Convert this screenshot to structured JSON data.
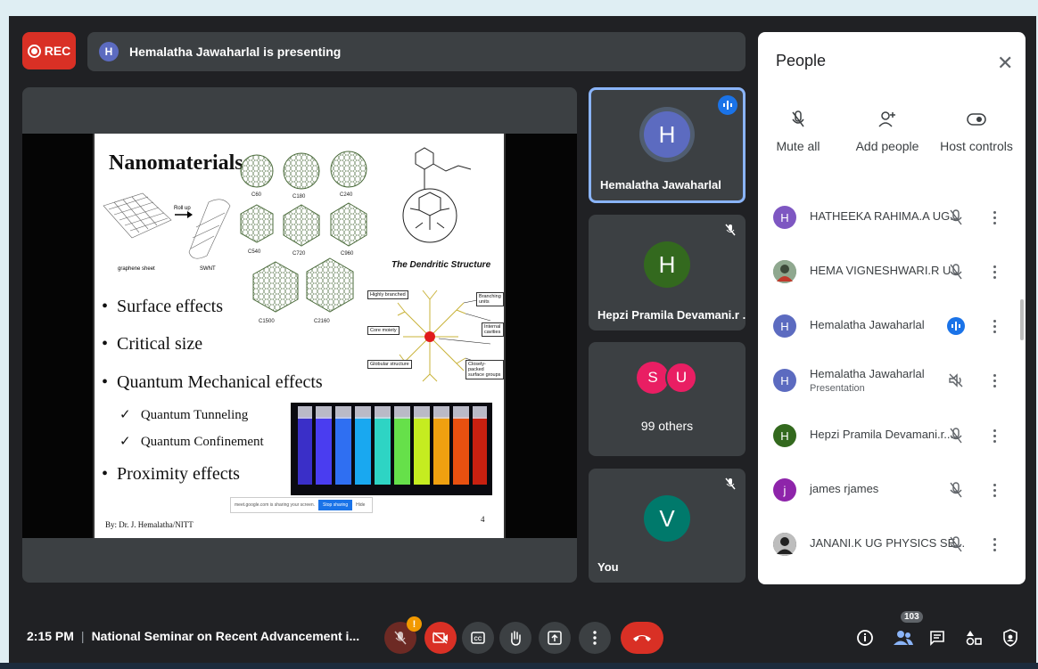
{
  "rec_label": "REC",
  "presenter": {
    "initial": "H",
    "banner": "Hemalatha Jawaharlal is presenting"
  },
  "slide": {
    "title": "Nanomaterials",
    "graphene_label": "graphene sheet",
    "roll_label": "Roll up",
    "swnt_label": "SWNT",
    "fullerene_labels": [
      "C60",
      "C180",
      "C240",
      "C540",
      "C720",
      "C960",
      "C1500",
      "C2160"
    ],
    "dendritic_title": "The Dendritic Structure",
    "dendritic_labels": [
      "Highly branched",
      "Branching units",
      "Core moiety",
      "Internal cavities",
      "Globular structure",
      "Closely-packed surface groups"
    ],
    "bullets": [
      "Surface effects",
      "Critical size",
      "Quantum Mechanical effects",
      "Proximity effects"
    ],
    "sub_bullets": [
      "Quantum Tunneling",
      "Quantum Confinement"
    ],
    "footer": "By: Dr. J. Hemalatha/NITT",
    "page_number": "4",
    "share_notice": "meet.google.com is sharing your screen.",
    "stop_sharing": "Stop sharing",
    "hide": "Hide"
  },
  "tiles": [
    {
      "initial": "H",
      "name": "Hemalatha Jawaharlal",
      "color": "#5c6bc0",
      "state": "speaking"
    },
    {
      "initial": "H",
      "name": "Hepzi Pramila Devamani.r ...",
      "color": "#33691e",
      "state": "muted"
    },
    {
      "initials": [
        "S",
        "U"
      ],
      "name": "99 others",
      "colors": [
        "#e91e63",
        "#e91e63"
      ]
    },
    {
      "initial": "V",
      "name": "You",
      "color": "#00796b",
      "state": "muted"
    }
  ],
  "people_panel": {
    "title": "People",
    "close_icon": "close-icon",
    "actions": [
      {
        "label": "Mute all",
        "icon": "mic-off-icon"
      },
      {
        "label": "Add people",
        "icon": "person-add-icon"
      },
      {
        "label": "Host controls",
        "icon": "toggle-icon"
      }
    ],
    "participants": [
      {
        "initial": "H",
        "name": "HATHEEKA RAHIMA.A UG...",
        "color": "#7e57c2",
        "mic": "muted"
      },
      {
        "initial": "",
        "name": "HEMA VIGNESHWARI.R U...",
        "color": "#6d8a70",
        "mic": "muted"
      },
      {
        "initial": "H",
        "name": "Hemalatha Jawaharlal",
        "color": "#5c6bc0",
        "mic": "speaking"
      },
      {
        "initial": "H",
        "name": "Hemalatha Jawaharlal",
        "sub": "Presentation",
        "color": "#5c6bc0",
        "mic": "presentation-audio-off"
      },
      {
        "initial": "H",
        "name": "Hepzi Pramila Devamani.r...",
        "color": "#33691e",
        "mic": "muted"
      },
      {
        "initial": "j",
        "name": "james rjames",
        "color": "#8e24aa",
        "mic": "muted"
      },
      {
        "initial": "",
        "name": "JANANI.K UG PHYSICS SE...",
        "color": "#424242",
        "mic": "muted"
      }
    ]
  },
  "bottom_bar": {
    "time": "2:15 PM",
    "meeting_title": "National Seminar on Recent Advancement i...",
    "warning_badge": "!",
    "participant_count": "103",
    "controls": [
      "mic-off-icon",
      "camera-off-icon",
      "captions-icon",
      "raise-hand-icon",
      "present-icon",
      "more-icon",
      "leave-call-icon"
    ],
    "right_icons": [
      "info-icon",
      "people-icon",
      "chat-icon",
      "activities-icon",
      "host-controls-icon"
    ]
  },
  "colors": {
    "accent": "#1a73e8",
    "danger": "#d93025",
    "surface": "#3c4043",
    "background": "#202124"
  }
}
